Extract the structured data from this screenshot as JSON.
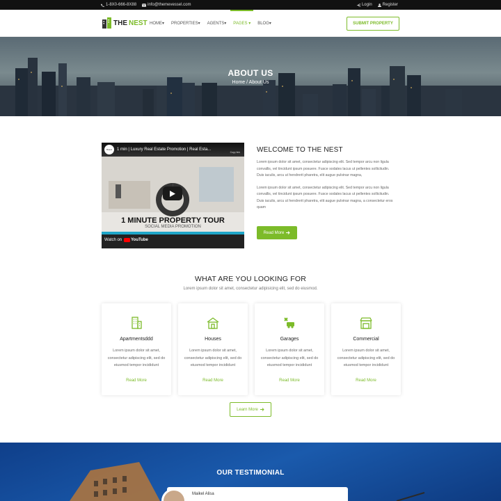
{
  "topbar": {
    "phone": "1-8X0-666-8X88",
    "email": "info@themevessel.com",
    "login": "Login",
    "register": "Register"
  },
  "logo": {
    "the": "THE",
    "nest": "NEST"
  },
  "nav": {
    "items": [
      "HOME",
      "PROPERTIES",
      "AGENTS",
      "PAGES",
      "BLOG"
    ],
    "submit": "SUBMIT PROPERTY"
  },
  "hero": {
    "title": "ABOUT US",
    "crumb_home": "Home",
    "crumb_sep": "/",
    "crumb_current": "About Us"
  },
  "video": {
    "title": "1 min | Luxury Real Estate Promotion | Real Esta...",
    "channel": "Brand",
    "headline": "1 MINUTE PROPERTY TOUR",
    "sub": "SOCIAL MEDIA PROMOTION",
    "watch": "Watch on",
    "yt": "YouTube",
    "copy": "Copy link"
  },
  "welcome": {
    "title": "WELCOME TO THE NEST",
    "p1": "Lorem ipsum dolor sit amet, consectetur adipiscing elit. Sed tempor arcu non ligula convallis, vel tincidunt ipsum posuere. Fusce sodales lacus ut pellentes sollicitudin. Duis iaculis, arcu ut hendrerit pharetra, elit augue pulvinar magna,",
    "p2": "Lorem ipsum dolor sit amet, consectetur adipiscing elit. Sed tempor arcu non ligula convallis, vel tincidunt ipsum posuere. Fusce sodales lacus ut pellentes sollicitudin. Duis iaculis, arcu ut hendrerit pharetra, elit augue pulvinar magna, a consectetur eros quam",
    "read_more": "Read More"
  },
  "looking": {
    "title": "WHAT ARE YOU LOOKING FOR",
    "subtitle": "Lorem ipsum dolor sit amet, consectetur adipisicing elit, sed do eiusmod.",
    "cards": [
      {
        "title": "Apartmentsddd",
        "icon": "apartment-icon",
        "desc": "Lorem ipsum dolor sit amet, consectetur adipiscing elit, sed do eiusmod tempor incididunt",
        "link": "Read More"
      },
      {
        "title": "Houses",
        "icon": "house-icon",
        "desc": "Lorem ipsum dolor sit amet, consectetur adipiscing elit, sed do eiusmod tempor incididunt",
        "link": "Read More"
      },
      {
        "title": "Garages",
        "icon": "garage-icon",
        "desc": "Lorem ipsum dolor sit amet, consectetur adipiscing elit, sed do eiusmod tempor incididunt",
        "link": "Read More"
      },
      {
        "title": "Commercial",
        "icon": "commercial-icon",
        "desc": "Lorem ipsum dolor sit amet, consectetur adipiscing elit, sed do eiusmod tempor incididunt",
        "link": "Read More"
      }
    ],
    "learn_more": "Learn More"
  },
  "testimonial": {
    "title": "OUR TESTIMONIAL",
    "name": "Maikel Alisa"
  },
  "colors": {
    "accent": "#7cbb29",
    "dark": "#111111",
    "blue": "#1a5aac"
  }
}
